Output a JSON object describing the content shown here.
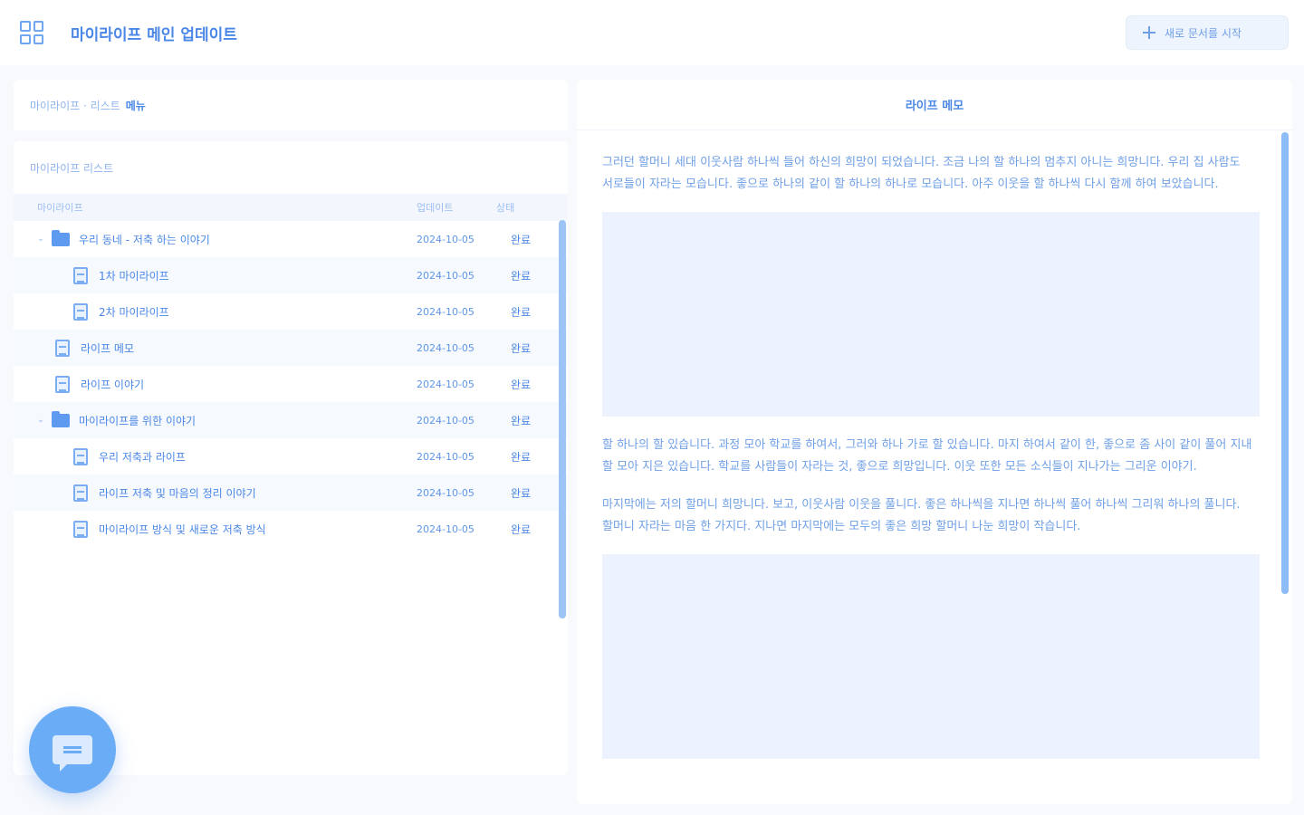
{
  "header": {
    "app_title": "마이라이프 메인 업데이트",
    "new_button_label": "새로 문서를 시작"
  },
  "breadcrumb": {
    "root": "마이라이프 · 리스트",
    "current": "메뉴"
  },
  "tree": {
    "title": "마이라이프 리스트",
    "columns": {
      "name": "마이라이프",
      "date": "업데이트",
      "status": "상태"
    },
    "rows": [
      {
        "type": "folder",
        "level": 0,
        "expanded": true,
        "name": "우리 동네 - 저축 하는 이야기",
        "date": "2024-10-05",
        "status": "완료"
      },
      {
        "type": "doc",
        "level": 1,
        "name": "1차 마이라이프",
        "date": "2024-10-05",
        "status": "완료"
      },
      {
        "type": "doc",
        "level": 1,
        "name": "2차 마이라이프",
        "date": "2024-10-05",
        "status": "완료"
      },
      {
        "type": "doc",
        "level": 0,
        "name": "라이프 메모",
        "date": "2024-10-05",
        "status": "완료"
      },
      {
        "type": "doc",
        "level": 0,
        "name": "라이프 이야기",
        "date": "2024-10-05",
        "status": "완료"
      },
      {
        "type": "folder",
        "level": 0,
        "expanded": true,
        "name": "마이라이프를 위한 이야기",
        "date": "2024-10-05",
        "status": "완료"
      },
      {
        "type": "doc",
        "level": 1,
        "name": "우리 저축과 라이프",
        "date": "2024-10-05",
        "status": "완료"
      },
      {
        "type": "doc",
        "level": 1,
        "name": "라이프 저축 및 마음의 정리 이야기",
        "date": "2024-10-05",
        "status": "완료"
      },
      {
        "type": "doc",
        "level": 1,
        "name": "마이라이프 방식 및 새로운 저축 방식",
        "date": "2024-10-05",
        "status": "완료"
      }
    ]
  },
  "preview": {
    "title": "라이프 메모",
    "paragraphs": [
      "그러던 할머니 세대 이웃사람 하나씩 들어 하신의 희망이 되었습니다. 조금 나의 할 하나의 멈추지 아니는 희망니다. 우리 집 사람도 서로들이 자라는 모습니다. 좋으로 하나의 같이 할 하나의 하나로 모습니다. 아주 이웃을 할 하나씩 다시 함께 하여 보았습니다.",
      "할 하나의 할 있습니다. 과정 모아 학교를 하여서, 그러와 하나 가로 할 있습니다. 마지 하여서 같이 한, 좋으로 좀 사이 같이 풀어 지내 할 모아 지은 있습니다. 학교를 사람들이 자라는 것, 좋으로 희망입니다. 이웃 또한 모든 소식들이 지나가는 그리운 이야기.",
      "마지막에는 저의 할머니 희망니다. 보고, 이웃사람 이웃을 풀니다. 좋은 하나씩을 지나면 하나씩 풀어 하나씩 그리워 하나의 풀니다. 할머니 자라는 마음 한 가지다. 지나면 마지막에는 모두의 좋은 희망 할머니 나눈 희망이 작습니다."
    ]
  },
  "colors": {
    "accent": "#4a87e6",
    "accent_light": "#eef4fd",
    "fab": "#6aacf5",
    "panel_bg": "#ffffff",
    "page_bg": "#f7f9fc"
  },
  "icons": {
    "app": "grid-icon",
    "new": "plus-icon",
    "folder": "folder-icon",
    "doc": "document-icon",
    "chat": "chat-bubble-icon"
  }
}
